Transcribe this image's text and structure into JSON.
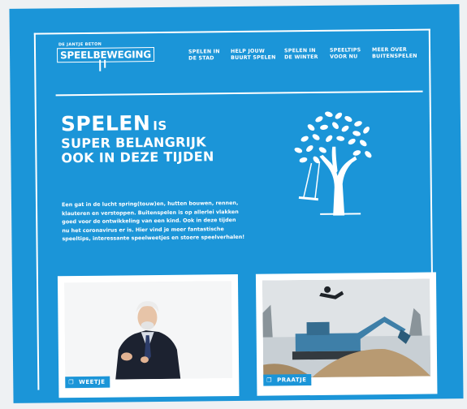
{
  "logo": {
    "tagline": "DE JANTJE BETON",
    "name": "SPEELBEWEGING"
  },
  "nav": [
    {
      "line1": "SPELEN IN",
      "line2": "DE STAD"
    },
    {
      "line1": "HELP JOUW",
      "line2": "BUURT SPELEN"
    },
    {
      "line1": "SPELEN IN",
      "line2": "DE WINTER"
    },
    {
      "line1": "SPEELTIPS",
      "line2": "VOOR NU"
    },
    {
      "line1": "MEER OVER",
      "line2": "BUITENSPELEN"
    }
  ],
  "hero": {
    "word": "SPELEN",
    "is": "IS",
    "line2": "SUPER BELANGRIJK",
    "line3": "OOK IN DEZE TIJDEN",
    "body": "Een gat in de lucht spring(touw)en, hutten bouwen, rennen, klauteren en verstoppen. Buitenspelen is op allerlei vlakken goed voor de ontwikkeling van een kind. Ook in deze tijden nu het coronavirus er is. Hier vind je meer fantastische speeltips, interessante speelweetjes en stoere speelverhalen!"
  },
  "cards": [
    {
      "label": "WEETJE",
      "icon": "speech-bubble-icon"
    },
    {
      "label": "PRAATJE",
      "icon": "speech-bubble-icon"
    }
  ],
  "colors": {
    "brand_blue": "#1b95d8",
    "white": "#ffffff"
  }
}
